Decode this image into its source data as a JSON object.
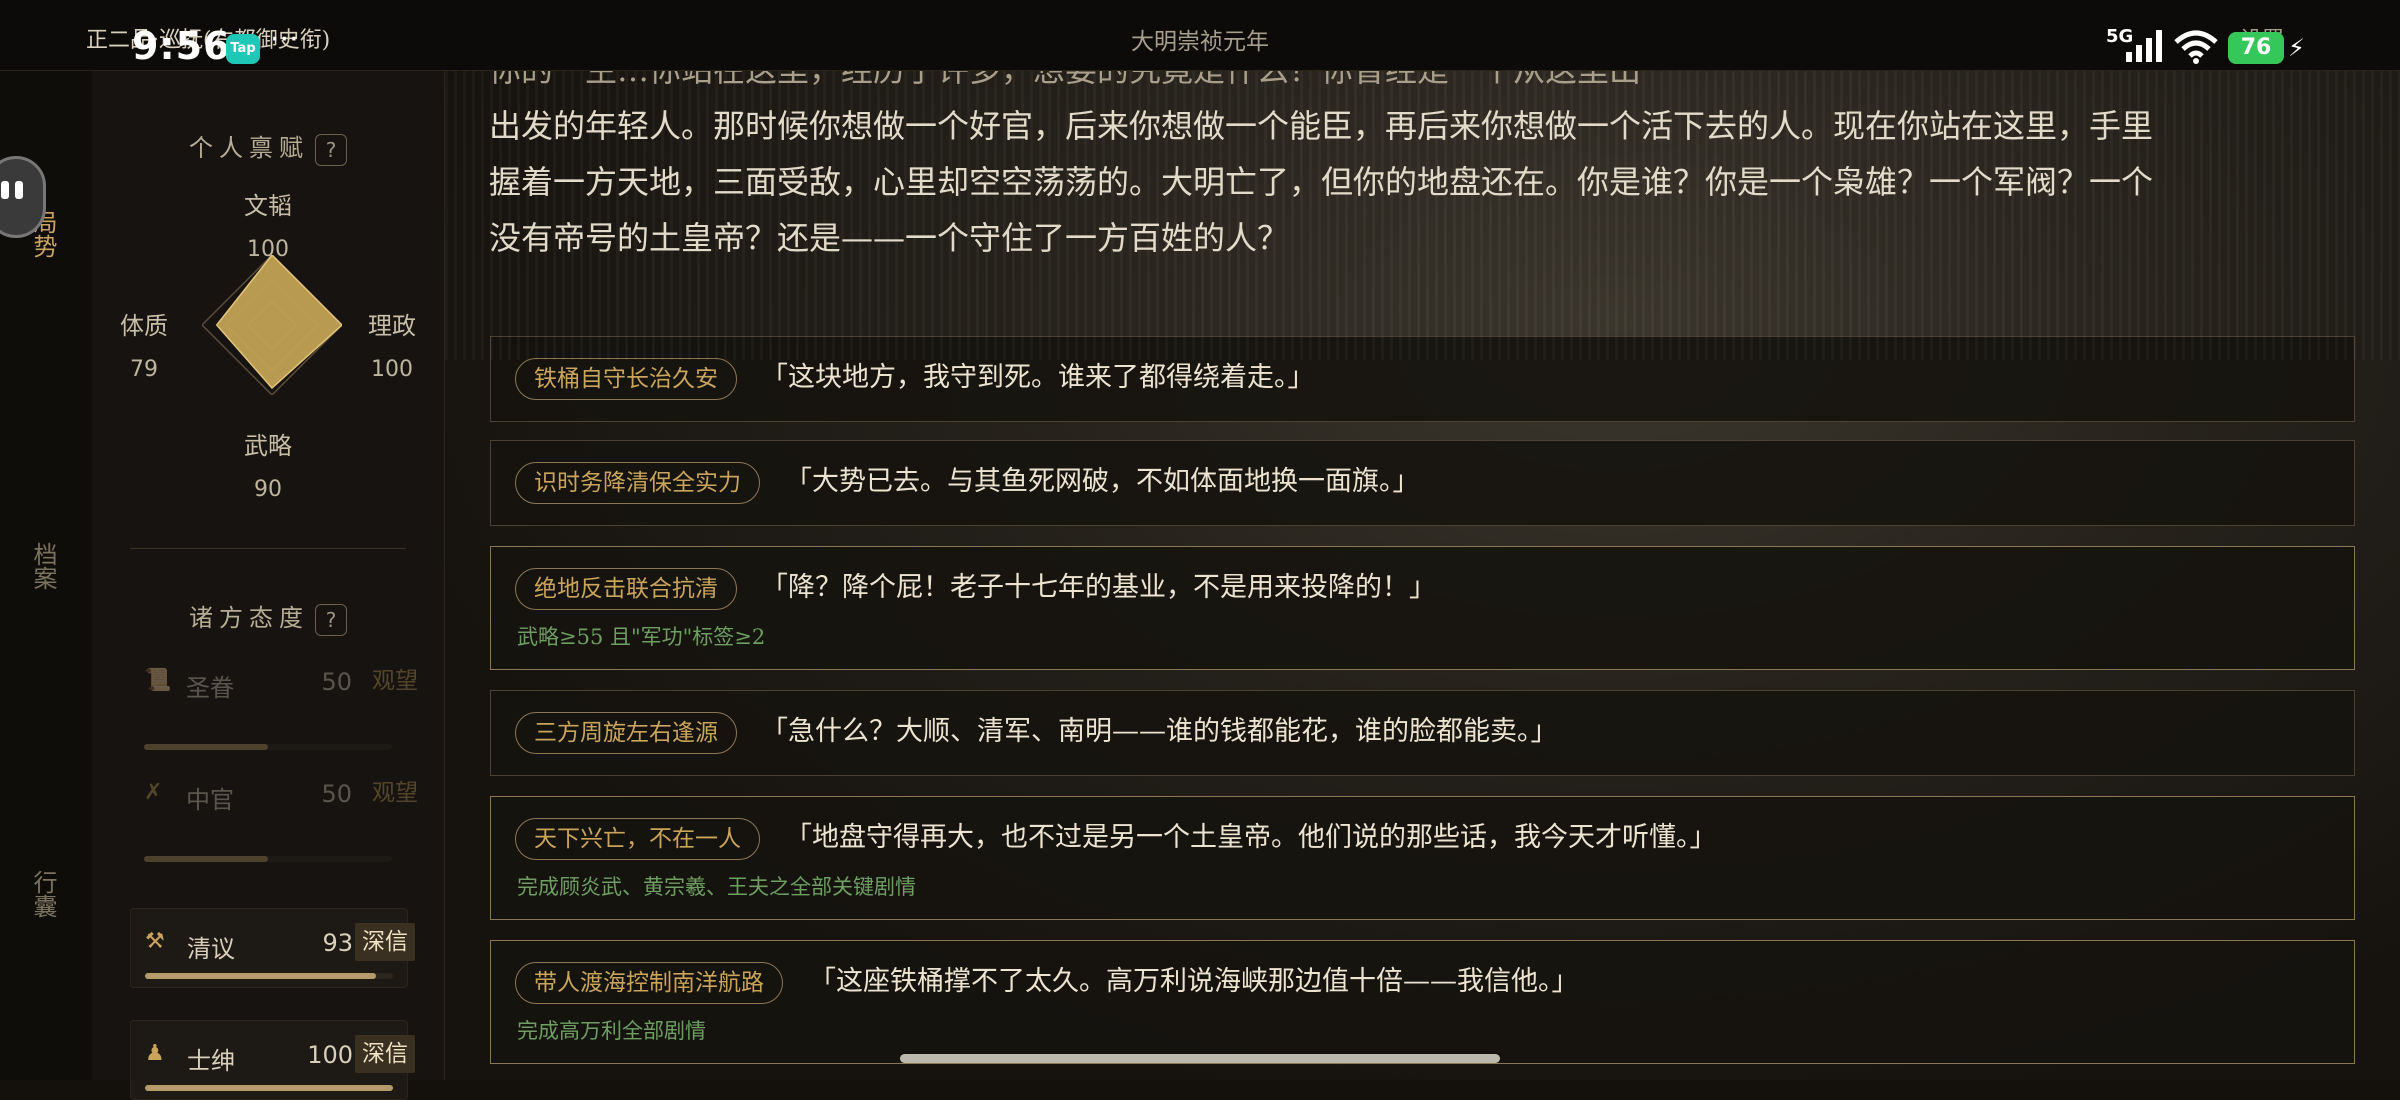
{
  "status_bar": {
    "rank": "正二品·巡抚(右都御史衔)",
    "era": "大明崇祯元年",
    "settings": "设置",
    "clock": "9:56",
    "tap_label": "Tap",
    "more": "···",
    "network": "5G",
    "battery": "76",
    "icons": [
      "tap-app-icon",
      "signal-icon",
      "wifi-icon",
      "battery-icon",
      "charging-bolt-icon"
    ]
  },
  "rail": {
    "tabs": [
      {
        "label": "局势",
        "active": true
      },
      {
        "label": "档案",
        "active": false
      },
      {
        "label": "行囊",
        "active": false
      }
    ]
  },
  "talents": {
    "title": "个人禀赋",
    "help": "?",
    "attributes": [
      {
        "name": "文韬",
        "value": 100
      },
      {
        "name": "理政",
        "value": 100
      },
      {
        "name": "武略",
        "value": 90
      },
      {
        "name": "体质",
        "value": 79
      }
    ]
  },
  "factions": {
    "title": "诸方态度",
    "help": "?",
    "items": [
      {
        "icon": "scroll-icon",
        "name": "圣眷",
        "value": "50",
        "status": "观望",
        "level": 0.5,
        "dim": true
      },
      {
        "icon": "crossed-brush-icon",
        "name": "中官",
        "value": "50",
        "status": "观望",
        "level": 0.5,
        "dim": true
      },
      {
        "icon": "crossed-tools-icon",
        "name": "清议",
        "value": "93",
        "status": "深信",
        "level": 0.93,
        "dim": false
      },
      {
        "icon": "gentry-figure-icon",
        "name": "士绅",
        "value": "100",
        "status": "深信",
        "level": 1.0,
        "dim": false
      }
    ]
  },
  "narrative": {
    "line0": "你的一生…你站在这里，经历了许多，想要的究竟是什么？你曾经是一个从这里出",
    "line1": "出发的年轻人。那时候你想做一个好官，后来你想做一个能臣，再后来你想做一个活下去的人。现在你站在这里，手里",
    "line2": "握着一方天地，三面受敌，心里却空空荡荡的。大明亡了，但你的地盘还在。你是谁？你是一个枭雄？一个军阀？一个",
    "line3": "没有帝号的土皇帝？还是——一个守住了一方百姓的人？"
  },
  "choices": [
    {
      "tag": "铁桶自守长治久安",
      "quote": "「这块地方，我守到死。谁来了都得绕着走。」",
      "requirement": ""
    },
    {
      "tag": "识时务降清保全实力",
      "quote": "「大势已去。与其鱼死网破，不如体面地换一面旗。」",
      "requirement": ""
    },
    {
      "tag": "绝地反击联合抗清",
      "quote": "「降？降个屁！老子十七年的基业，不是用来投降的！」",
      "requirement": "武略≥55 且\"军功\"标签≥2"
    },
    {
      "tag": "三方周旋左右逢源",
      "quote": "「急什么？大顺、清军、南明——谁的钱都能花，谁的脸都能卖。」",
      "requirement": ""
    },
    {
      "tag": "天下兴亡，不在一人",
      "quote": "「地盘守得再大，也不过是另一个土皇帝。他们说的那些话，我今天才听懂。」",
      "requirement": "完成顾炎武、黄宗羲、王夫之全部关键剧情"
    },
    {
      "tag": "带人渡海控制南洋航路",
      "quote": "「这座铁桶撑不了太久。高万利说海峡那边值十倍——我信他。」",
      "requirement": "完成高万利全部剧情"
    }
  ]
}
